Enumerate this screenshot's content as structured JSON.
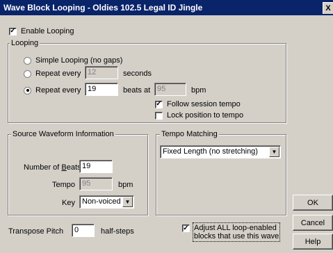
{
  "title": "Wave Block Looping - Oldies 102.5 Legal ID Jingle",
  "close_label": "X",
  "enable_looping": {
    "label": "Enable Looping",
    "checked": true
  },
  "looping_group": {
    "label": "Looping",
    "simple": "Simple Looping (no gaps)",
    "repeat_seconds": {
      "label": "Repeat every",
      "value": "12",
      "unit": "seconds"
    },
    "repeat_beats": {
      "label": "Repeat every",
      "value": "19",
      "beats_at": "beats at",
      "bpm_value": "95",
      "bpm_label": "bpm"
    },
    "follow_tempo": {
      "label": "Follow session tempo",
      "checked": true
    },
    "lock_position": {
      "label": "Lock position to tempo",
      "checked": false
    }
  },
  "source_group": {
    "label": "Source Waveform Information",
    "beats_label_pre": "Number of ",
    "beats_label_u": "B",
    "beats_label_post": "eats",
    "beats_value": "19",
    "tempo_label": "Tempo",
    "tempo_value": "95",
    "tempo_unit": "bpm",
    "key_label": "Key",
    "key_value": "Non-voiced"
  },
  "tempo_group": {
    "label": "Tempo Matching",
    "mode_value": "Fixed Length (no stretching)"
  },
  "transpose": {
    "label": "Transpose Pitch",
    "value": "0",
    "unit": "half-steps"
  },
  "adjust_all": {
    "label_line1": "Adjust ALL loop-enabled",
    "label_line2": "blocks that use this wave",
    "checked": true
  },
  "buttons": {
    "ok": "OK",
    "cancel": "Cancel",
    "help": "Help"
  }
}
